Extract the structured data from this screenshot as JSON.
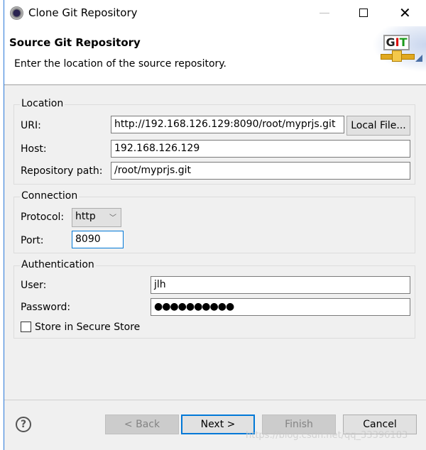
{
  "window": {
    "title": "Clone Git Repository",
    "icon": "eclipse-gear-icon"
  },
  "header": {
    "title": "Source Git Repository",
    "description": "Enter the location of the source repository.",
    "logo_text": "GIT"
  },
  "location": {
    "group_label": "Location",
    "uri_label": "URI:",
    "uri_value": "http://192.168.126.129:8090/root/myprjs.git",
    "local_file_button": "Local File...",
    "host_label": "Host:",
    "host_value": "192.168.126.129",
    "repo_path_label": "Repository path:",
    "repo_path_value": "/root/myprjs.git"
  },
  "connection": {
    "group_label": "Connection",
    "protocol_label": "Protocol:",
    "protocol_value": "http",
    "port_label": "Port:",
    "port_value": "8090"
  },
  "authentication": {
    "group_label": "Authentication",
    "user_label": "User:",
    "user_value": "jlh",
    "password_label": "Password:",
    "password_value": "●●●●●●●●●●",
    "store_label": "Store in Secure Store",
    "store_checked": false
  },
  "footer": {
    "back": "< Back",
    "next": "Next >",
    "finish": "Finish",
    "cancel": "Cancel"
  },
  "watermark": "https://blog.csdn.net/qq_33396183",
  "colors": {
    "accent": "#0078d7",
    "dialog_bg": "#f0f0f0"
  }
}
